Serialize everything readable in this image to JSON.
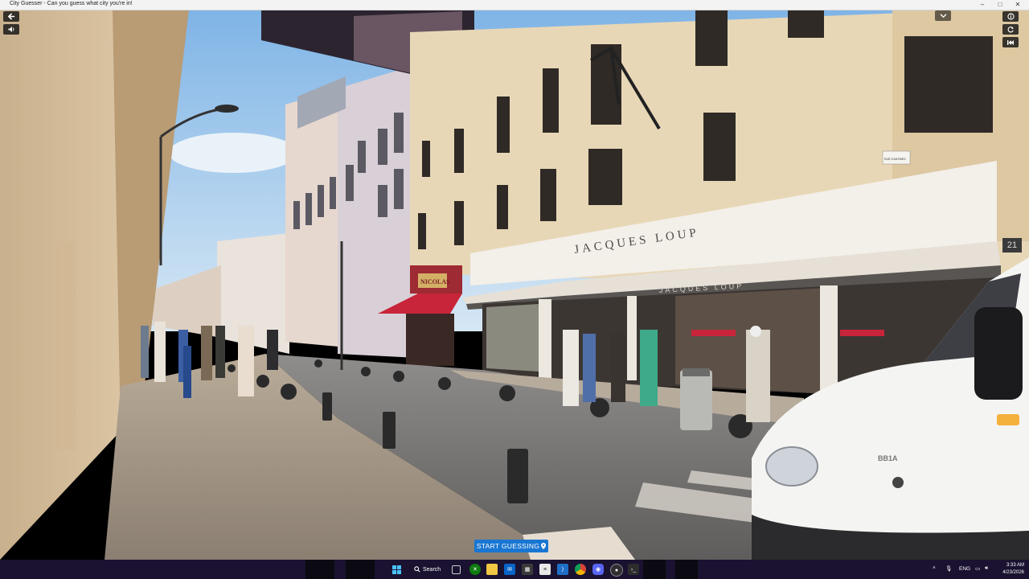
{
  "window": {
    "title": "City Guesser - Can you guess what city you're in!",
    "minimize_glyph": "–",
    "maximize_glyph": "□",
    "close_glyph": "✕"
  },
  "controls": {
    "back_icon": "arrow-left-icon",
    "volume_icon": "volume-icon",
    "collapse_icon": "chevron-down-icon",
    "info_icon": "info-icon",
    "refresh_icon": "refresh-icon",
    "restart_icon": "skip-back-icon"
  },
  "scene": {
    "store_sign": "JACQUES LOUP",
    "awning_text": "JACQUES LOUP",
    "shop_sign": "NICOLAS",
    "street_sign": "RUE D'ANTIBES",
    "street_number": "21",
    "van_badge": "BB1A"
  },
  "start_button": {
    "label": "START GUESSING",
    "icon": "map-pin-icon"
  },
  "taskbar": {
    "search_label": "Search",
    "language": "ENG",
    "time": "3:33 AM",
    "date": "4/23/2026",
    "apps": [
      "start-icon",
      "search-icon",
      "task-view-icon",
      "xbox-icon",
      "file-explorer-icon",
      "mail-icon",
      "calculator-icon",
      "notepad-icon",
      "vscode-icon",
      "chrome-icon",
      "discord-icon",
      "obs-icon",
      "terminal-icon"
    ]
  },
  "colors": {
    "accent": "#1976d2",
    "sky": "#a9cfee",
    "facade": "#e8d7b6",
    "awning": "#f1ece3",
    "shop_red": "#c8243a",
    "taskbar": "#1a1230"
  }
}
